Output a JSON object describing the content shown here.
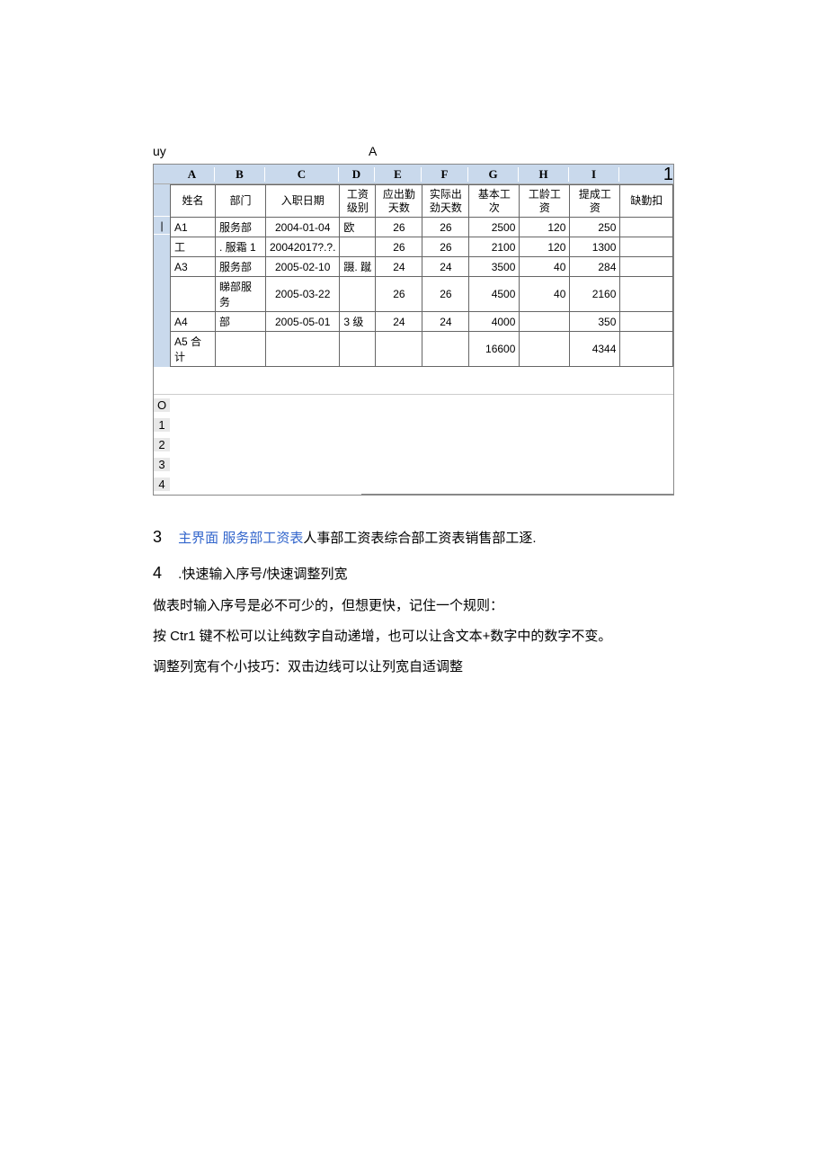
{
  "top_labels": {
    "left": "uy",
    "right": "A"
  },
  "col_headers": [
    "A",
    "B",
    "C",
    "D",
    "E",
    "F",
    "G",
    "H",
    "I"
  ],
  "right_corner": "1",
  "table_headers": [
    "姓名",
    "部门",
    "入职日期",
    "工资级别",
    "应出勤天数",
    "实际出劲天数",
    "基本工次",
    "工龄工资",
    "提成工资",
    "缺勤扣"
  ],
  "rows": [
    {
      "a": "A1",
      "b": "服务部",
      "c": "2004-01-04",
      "d": "欧",
      "e": "26",
      "f": "26",
      "g": "2500",
      "h": "120",
      "i": "250",
      "j": ""
    },
    {
      "a": "工",
      "b": ". 服霜 1",
      "c": "20042017?.?.",
      "d": "",
      "e": "26",
      "f": "26",
      "g": "2100",
      "h": "120",
      "i": "1300",
      "j": ""
    },
    {
      "a": "A3",
      "b": "服务部",
      "c": "2005-02-10",
      "d": "蹑. 蹴",
      "e": "24",
      "f": "24",
      "g": "3500",
      "h": "40",
      "i": "284",
      "j": ""
    },
    {
      "a": "",
      "b": "睇部服务",
      "c": "2005-03-22",
      "d": "",
      "e": "26",
      "f": "26",
      "g": "4500",
      "h": "40",
      "i": "2160",
      "j": ""
    },
    {
      "a": "A4",
      "b": "部",
      "c": "2005-05-01",
      "d": "3 级",
      "e": "24",
      "f": "24",
      "g": "4000",
      "h": "",
      "i": "350",
      "j": ""
    },
    {
      "a": "A5 合计",
      "b": "",
      "c": "",
      "d": "",
      "e": "",
      "f": "",
      "g": "16600",
      "h": "",
      "i": "4344",
      "j": ""
    }
  ],
  "blank_row_labels": [
    "",
    "O",
    "1",
    "2",
    "3",
    "4"
  ],
  "paragraphs": {
    "p1_idx": "3",
    "p1_link": "主界面  服务部工资表",
    "p1_rest": "人事部工资表综合部工资表销售部工逐.",
    "p2_idx": "4",
    "p2_text": ".快速输入序号/快速调整列宽",
    "p3": "做表时输入序号是必不可少的，但想更快，记住一个规则：",
    "p4": "按 Ctr1 键不松可以让纯数字自动递增，也可以让含文本+数字中的数字不变。",
    "p5": "调整列宽有个小技巧：双击边线可以让列宽自适调整"
  }
}
